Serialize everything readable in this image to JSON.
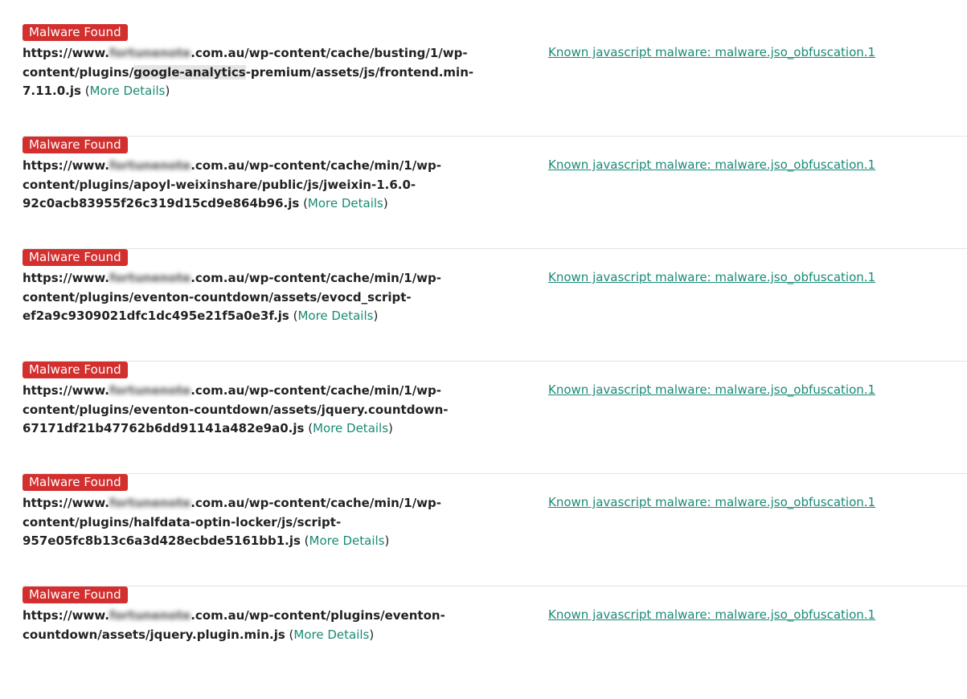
{
  "results": [
    {
      "badge": "Malware Found",
      "url_prefix": "https://www.",
      "url_hidden": "fortunenote",
      "url_mid1": ".com.au/wp-content/cache/busting/1/wp-content/plugins/",
      "url_highlight": "google-analytics",
      "url_rest": "-premium/assets/js/frontend.min-7.11.0.js",
      "more_open": " (",
      "more_label": "More Details",
      "more_close": ")",
      "signature": "Known javascript malware: malware.jso_obfuscation.1"
    },
    {
      "badge": "Malware Found",
      "url_prefix": "https://www.",
      "url_hidden": "fortunenote",
      "url_mid1": ".com.au/wp-content/cache/min/1/wp-content/plugins/apoyl-weixinshare/public/js/jweixin-1.6.0-92c0acb83955f26c319d15cd9e864b96.js",
      "url_highlight": "",
      "url_rest": "",
      "more_open": " (",
      "more_label": "More Details",
      "more_close": ")",
      "signature": "Known javascript malware: malware.jso_obfuscation.1"
    },
    {
      "badge": "Malware Found",
      "url_prefix": "https://www.",
      "url_hidden": "fortunenote",
      "url_mid1": ".com.au/wp-content/cache/min/1/wp-content/plugins/eventon-countdown/assets/evocd_script-ef2a9c9309021dfc1dc495e21f5a0e3f.js",
      "url_highlight": "",
      "url_rest": "",
      "more_open": " (",
      "more_label": "More Details",
      "more_close": ")",
      "signature": "Known javascript malware: malware.jso_obfuscation.1"
    },
    {
      "badge": "Malware Found",
      "url_prefix": "https://www.",
      "url_hidden": "fortunenote",
      "url_mid1": ".com.au/wp-content/cache/min/1/wp-content/plugins/eventon-countdown/assets/jquery.countdown-67171df21b47762b6dd91141a482e9a0.js",
      "url_highlight": "",
      "url_rest": "",
      "more_open": " (",
      "more_label": "More Details",
      "more_close": ")",
      "signature": "Known javascript malware: malware.jso_obfuscation.1"
    },
    {
      "badge": "Malware Found",
      "url_prefix": "https://www.",
      "url_hidden": "fortunenote",
      "url_mid1": ".com.au/wp-content/cache/min/1/wp-content/plugins/halfdata-optin-locker/js/script-957e05fc8b13c6a3d428ecbde5161bb1.js",
      "url_highlight": "",
      "url_rest": "",
      "more_open": " (",
      "more_label": "More Details",
      "more_close": ")",
      "signature": "Known javascript malware: malware.jso_obfuscation.1"
    },
    {
      "badge": "Malware Found",
      "url_prefix": "https://www.",
      "url_hidden": "fortunenote",
      "url_mid1": ".com.au/wp-content/plugins/eventon-countdown/assets/jquery.plugin.min.js",
      "url_highlight": "",
      "url_rest": "",
      "more_open": " (",
      "more_label": "More Details",
      "more_close": ")",
      "signature": "Known javascript malware: malware.jso_obfuscation.1"
    }
  ],
  "colors": {
    "badge_bg": "#d32f2f",
    "link": "#1a8a76",
    "divider": "#e4e4e4"
  }
}
